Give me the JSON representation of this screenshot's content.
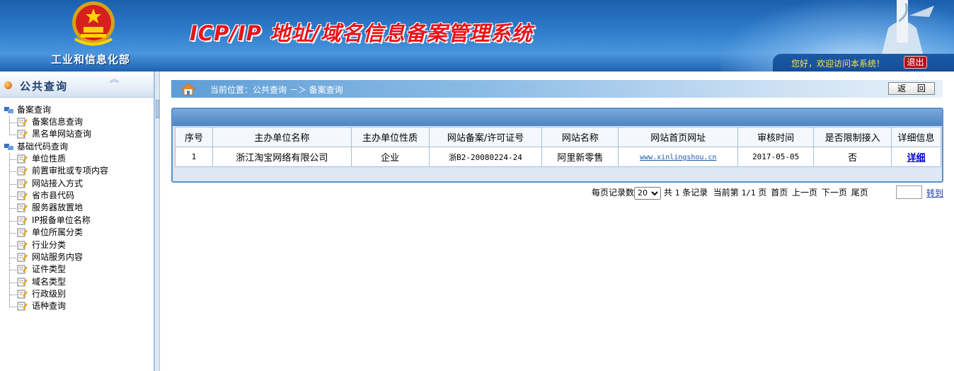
{
  "header": {
    "ministry": "工业和信息化部",
    "system_title": "ICP/IP 地址/域名信息备案管理系统",
    "welcome": "您好，欢迎访问本系统！",
    "logout": "退出"
  },
  "sidebar": {
    "title": "公共查询",
    "groups": [
      {
        "label": "备案查询",
        "items": [
          "备案信息查询",
          "黑名单网站查询"
        ]
      },
      {
        "label": "基础代码查询",
        "items": [
          "单位性质",
          "前置审批或专项内容",
          "网站接入方式",
          "省市县代码",
          "服务器放置地",
          "IP报备单位名称",
          "单位所属分类",
          "行业分类",
          "网站服务内容",
          "证件类型",
          "域名类型",
          "行政级别",
          "语种查询"
        ]
      }
    ]
  },
  "breadcrumb": {
    "prefix": "当前位置：",
    "path1": "公共查询",
    "arrow": " －＞ ",
    "path2": "备案查询"
  },
  "back_button": "返 回",
  "table": {
    "columns": [
      "序号",
      "主办单位名称",
      "主办单位性质",
      "网站备案/许可证号",
      "网站名称",
      "网站首页网址",
      "审核时间",
      "是否限制接入",
      "详细信息"
    ],
    "rows": [
      {
        "index": "1",
        "org_name": "浙江淘宝网络有限公司",
        "org_type": "企业",
        "license": "浙B2-20080224-24",
        "site_name": "阿里新零售",
        "url": "www.xinlingshou.cn",
        "audit_date": "2017-05-05",
        "restricted": "否",
        "detail": "详细"
      }
    ]
  },
  "pager": {
    "per_page_label": "每页记录数",
    "per_page_value": "20",
    "total_prefix": "共",
    "total": "1",
    "total_suffix": "条记录",
    "current_prefix": "当前第",
    "current": "1/1",
    "current_suffix": "页",
    "first": "首页",
    "prev": "上一页",
    "next": "下一页",
    "last": "尾页",
    "jump": "转到"
  }
}
